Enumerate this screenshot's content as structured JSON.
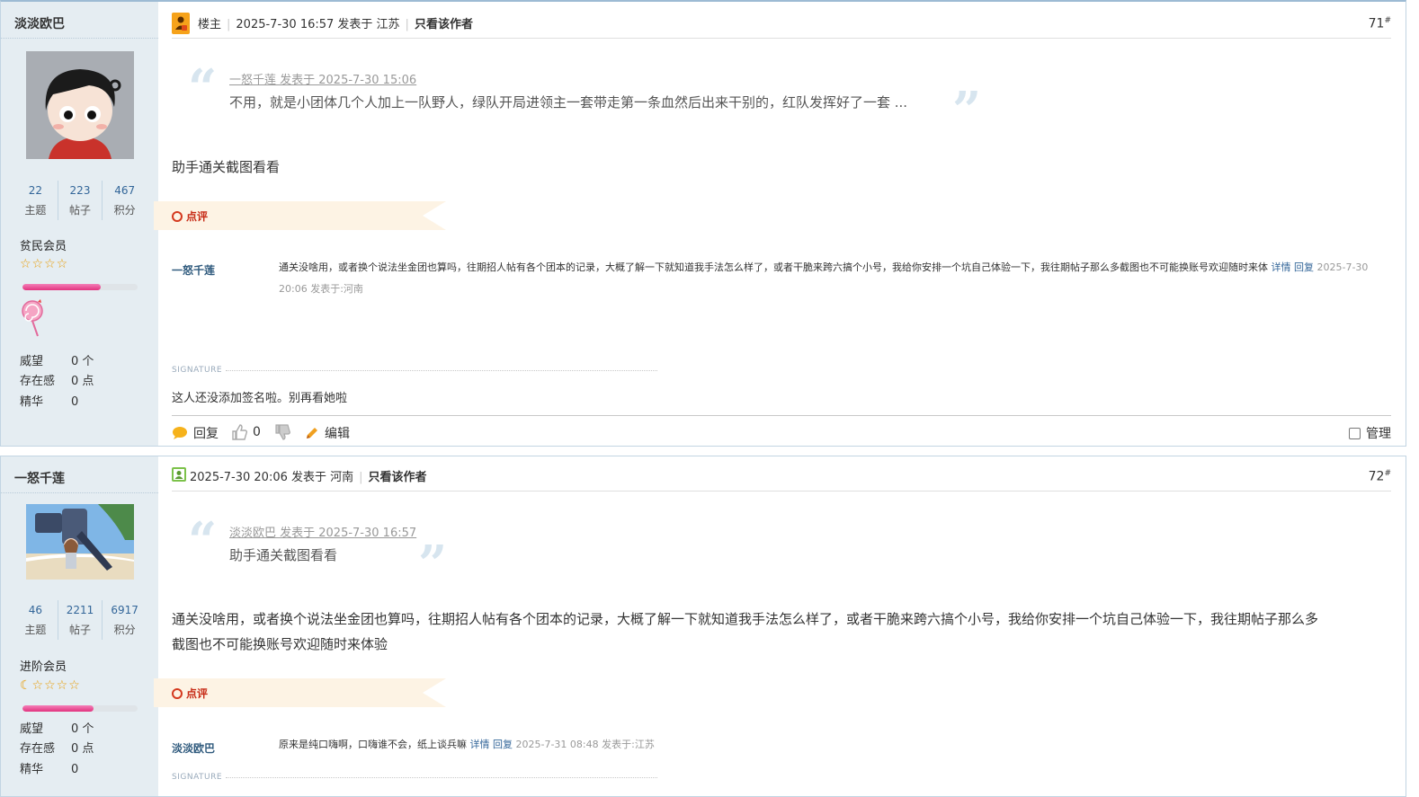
{
  "post71": {
    "author": "淡淡欧巴",
    "stats": [
      {
        "num": "22",
        "label": "主题"
      },
      {
        "num": "223",
        "label": "帖子"
      },
      {
        "num": "467",
        "label": "积分"
      }
    ],
    "rank": "贫民会员",
    "stars": "☆☆☆☆",
    "progress": 0.68,
    "weiwang_label": "威望",
    "weiwang_value": "0 个",
    "cunzai_label": "存在感",
    "cunzai_value": "0 点",
    "jinghua_label": "精华",
    "jinghua_value": "0",
    "owner_label": "楼主",
    "date": "2025-7-30 16:57 发表于 江苏",
    "only_author": "只看该作者",
    "floor": "71",
    "quote_head": "一怒千莲 发表于 2025-7-30 15:06",
    "quote_body": "不用，就是小团体几个人加上一队野人，绿队开局进领主一套带走第一条血然后出来干别的，红队发挥好了一套 ...",
    "content": "助手通关截图看看",
    "comment_label": "点评",
    "comment_user": "一怒千莲",
    "comment_text": "通关没啥用，或者换个说法坐金团也算吗，往期招人帖有各个团本的记录，大概了解一下就知道我手法怎么样了，或者干脆来跨六搞个小号，我给你安排一个坑自己体验一下，我往期帖子那么多截图也不可能换账号欢迎随时来体",
    "comment_detail": "详情",
    "comment_reply": "回复",
    "comment_meta": "2025-7-30 20:06 发表于:河南",
    "sig_label": "SIGNATURE",
    "sig_text": "这人还没添加签名啦。别再看她啦",
    "reply_label": "回复",
    "like_count": "0",
    "edit_label": "编辑",
    "manage_label": "管理"
  },
  "post72": {
    "author": "一怒千莲",
    "stats": [
      {
        "num": "46",
        "label": "主题"
      },
      {
        "num": "2211",
        "label": "帖子"
      },
      {
        "num": "6917",
        "label": "积分"
      }
    ],
    "rank": "进阶会员",
    "stars": "☾☆☆☆☆",
    "progress": 0.62,
    "weiwang_label": "威望",
    "weiwang_value": "0 个",
    "cunzai_label": "存在感",
    "cunzai_value": "0 点",
    "jinghua_label": "精华",
    "jinghua_value": "0",
    "date": "2025-7-30 20:06 发表于 河南",
    "only_author": "只看该作者",
    "floor": "72",
    "quote_head": "淡淡欧巴 发表于 2025-7-30 16:57",
    "quote_body": "助手通关截图看看",
    "content_line1": "通关没啥用，或者换个说法坐金团也算吗，往期招人帖有各个团本的记录，大概了解一下就知道我手法怎么样了，或者干脆来跨六搞个小号，我给你安排一个坑自己体验一下，我往期帖子那么多",
    "content_line2": "截图也不可能换账号欢迎随时来体验",
    "comment_label": "点评",
    "comment_user": "淡淡欧巴",
    "comment_text": "原来是纯口嗨啊，口嗨谁不会，纸上谈兵嘛",
    "comment_detail": "详情",
    "comment_reply": "回复",
    "comment_meta": "2025-7-31 08:48 发表于:江苏",
    "sig_label": "SIGNATURE"
  },
  "colors": {
    "accent": "#336699",
    "sidebar": "#e5edf2",
    "comment_bg": "#fdf3e4",
    "comment_red": "#c72a15"
  }
}
